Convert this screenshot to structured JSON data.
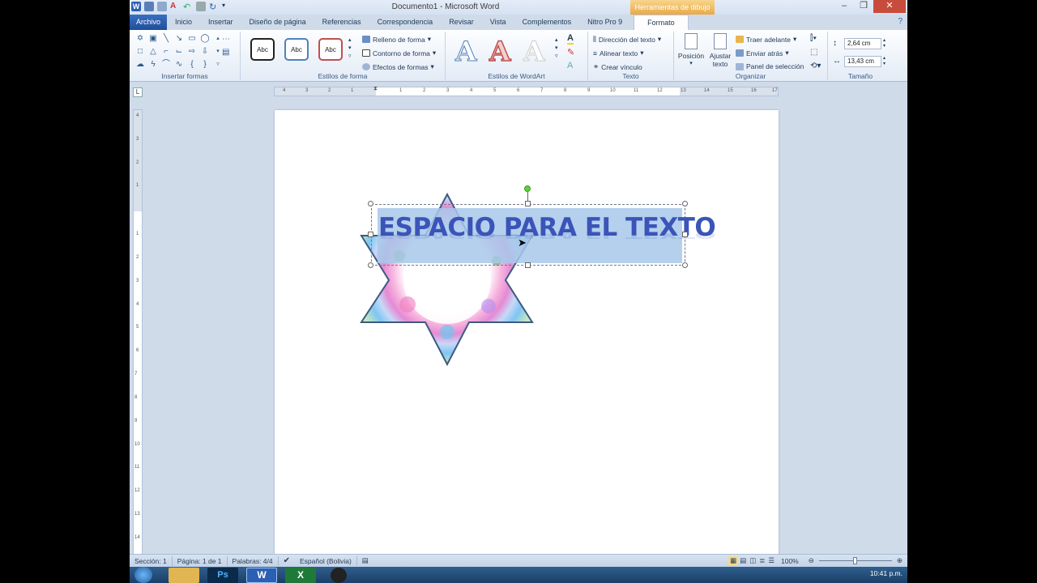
{
  "window": {
    "title": "Documento1 - Microsoft Word",
    "context_header": "Herramientas de dibujo"
  },
  "tabs": [
    "Archivo",
    "Inicio",
    "Insertar",
    "Diseño de página",
    "Referencias",
    "Correspondencia",
    "Revisar",
    "Vista",
    "Complementos",
    "Nitro Pro 9",
    "Formato"
  ],
  "ribbon": {
    "groups": {
      "insert_shapes": "Insertar formas",
      "shape_styles": "Estilos de forma",
      "wordart_styles": "Estilos de WordArt",
      "text": "Texto",
      "arrange": "Organizar",
      "size": "Tamaño"
    },
    "style_sample": "Abc",
    "shape_fill": "Relleno de forma",
    "shape_outline": "Contorno de forma",
    "shape_effects": "Efectos de formas",
    "wordart_sample": "A",
    "text_direction": "Dirección del texto",
    "align_text": "Alinear texto",
    "create_link": "Crear vínculo",
    "position": "Posición",
    "wrap_text_1": "Ajustar",
    "wrap_text_2": "texto",
    "bring_forward": "Traer adelante",
    "send_backward": "Enviar atrás",
    "selection_pane": "Panel de selección",
    "height": "2,64 cm",
    "width": "13,43 cm"
  },
  "ruler_h": [
    "4",
    "3",
    "2",
    "1",
    "1",
    "2",
    "3",
    "4",
    "5",
    "6",
    "7",
    "8",
    "9",
    "10",
    "11",
    "12",
    "13",
    "14",
    "15",
    "16",
    "17"
  ],
  "ruler_v": [
    "4",
    "3",
    "2",
    "1",
    "1",
    "2",
    "3",
    "4",
    "5",
    "6",
    "7",
    "8",
    "9",
    "10",
    "11",
    "12",
    "13",
    "14"
  ],
  "document": {
    "textbox_text": "ESPACIO PARA EL TEXTO"
  },
  "status": {
    "section": "Sección: 1",
    "page": "Página: 1 de 1",
    "words": "Palabras: 4/4",
    "language": "Español (Bolivia)",
    "zoom": "100%"
  },
  "taskbar": {
    "time": "10:41 p.m."
  }
}
